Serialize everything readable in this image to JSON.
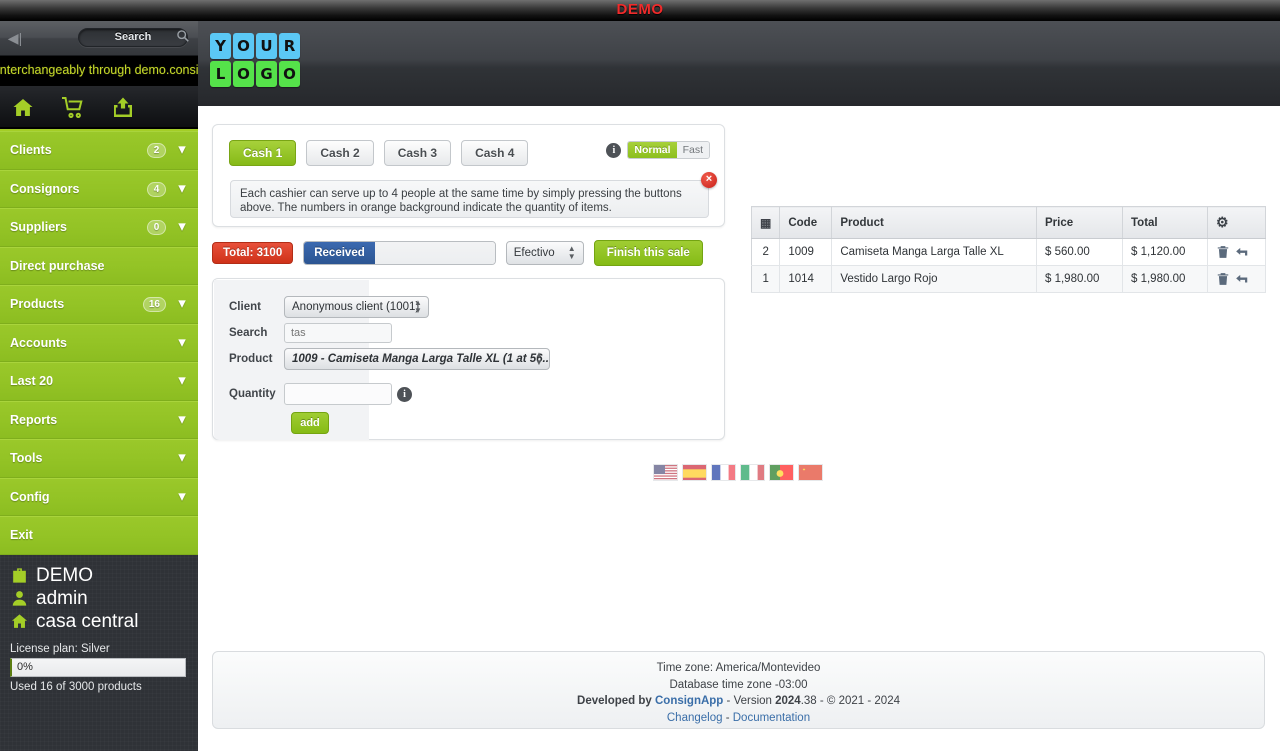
{
  "top_bar": {
    "demo_label": "DEMO"
  },
  "sidebar": {
    "collapse_icon": "collapse-left-icon",
    "search": {
      "label": "Search",
      "icon": "search-icon"
    },
    "marquee": "interchangeably through demo.consignapp.c",
    "quick_icons": [
      {
        "name": "home-icon",
        "label": "Home"
      },
      {
        "name": "cart-icon",
        "label": "Cart"
      },
      {
        "name": "share-icon",
        "label": "Share"
      }
    ],
    "items": [
      {
        "label": "Clients",
        "badge": "2",
        "chevron": true
      },
      {
        "label": "Consignors",
        "badge": "4",
        "chevron": true
      },
      {
        "label": "Suppliers",
        "badge": "0",
        "chevron": true
      },
      {
        "label": "Direct purchase",
        "badge": "",
        "chevron": false
      },
      {
        "label": "Products",
        "badge": "16",
        "chevron": true
      },
      {
        "label": "Accounts",
        "badge": "",
        "chevron": true
      },
      {
        "label": "Last 20",
        "badge": "",
        "chevron": true
      },
      {
        "label": "Reports",
        "badge": "",
        "chevron": true
      },
      {
        "label": "Tools",
        "badge": "",
        "chevron": true
      },
      {
        "label": "Config",
        "badge": "",
        "chevron": true
      },
      {
        "label": "Exit",
        "badge": "",
        "chevron": false
      }
    ],
    "account": {
      "company": "DEMO",
      "user": "admin",
      "branch": "casa central",
      "license_label": "License plan: Silver",
      "usage_percent": "0%",
      "usage_text": "Used 16 of 3000 products"
    }
  },
  "header": {
    "logo_top": [
      "Y",
      "O",
      "U",
      "R"
    ],
    "logo_bottom": [
      "L",
      "O",
      "G",
      "O"
    ],
    "logo_top_color": "#5bc8f5",
    "logo_bottom_color": "#55e24a"
  },
  "cash_panel": {
    "tabs": [
      {
        "label": "Cash 1",
        "active": true
      },
      {
        "label": "Cash 2",
        "active": false
      },
      {
        "label": "Cash 3",
        "active": false
      },
      {
        "label": "Cash 4",
        "active": false
      }
    ],
    "info_icon": "info-icon",
    "speed": {
      "normal": "Normal",
      "fast": "Fast",
      "selected": "Normal"
    },
    "notice": "Each cashier can serve up to 4 people at the same time by simply pressing the buttons above. The numbers in orange background indicate the quantity of items.",
    "close_icon": "close-icon"
  },
  "totals": {
    "total_label": "Total: 3100",
    "received_label": "Received",
    "received_value": "",
    "payment_method": "Efectivo",
    "finish_label": "Finish this sale",
    "accent_total": "#cf3219",
    "accent_received": "#2c5592",
    "accent_finish": "#85bb16"
  },
  "sale_form": {
    "client_label": "Client",
    "client_value": "Anonymous client (1001)",
    "search_label": "Search",
    "search_value": "",
    "search_placeholder": "tas",
    "product_label": "Product",
    "product_value": "1009 - Camiseta Manga Larga Talle XL (1 at 56...",
    "quantity_label": "Quantity",
    "quantity_value": "",
    "quantity_info_icon": "info-icon",
    "add_label": "add"
  },
  "languages": [
    {
      "name": "flag-us",
      "title": "English"
    },
    {
      "name": "flag-es",
      "title": "Espanol"
    },
    {
      "name": "flag-fr",
      "title": "Francais"
    },
    {
      "name": "flag-it",
      "title": "Italiano"
    },
    {
      "name": "flag-pt",
      "title": "Portugues"
    },
    {
      "name": "flag-cn",
      "title": "Chinese"
    }
  ],
  "cart_table": {
    "columns": [
      "",
      "Code",
      "Product",
      "Price",
      "Total",
      ""
    ],
    "grid_icon": "grid-icon",
    "gear_icon": "gear-icon",
    "rows": [
      {
        "qty": "2",
        "code": "1009",
        "product": "Camiseta Manga Larga Talle XL",
        "price": "$ 560.00",
        "total": "$ 1,120.00"
      },
      {
        "qty": "1",
        "code": "1014",
        "product": "Vestido Largo Rojo",
        "price": "$ 1,980.00",
        "total": "$ 1,980.00"
      }
    ],
    "row_actions": [
      {
        "name": "delete-icon",
        "title": "Delete"
      },
      {
        "name": "undo-icon",
        "title": "Return"
      }
    ]
  },
  "footer": {
    "timezone": "Time zone: America/Montevideo",
    "db_timezone": "Database time zone -03:00",
    "developed_by_prefix": "Developed by ",
    "brand": "ConsignApp",
    "version_text": " - Version ",
    "version_major": "2024",
    "version_minor": ".38 - © 2021 - 2024",
    "changelog": "Changelog",
    "separator": " - ",
    "documentation": "Documentation"
  }
}
